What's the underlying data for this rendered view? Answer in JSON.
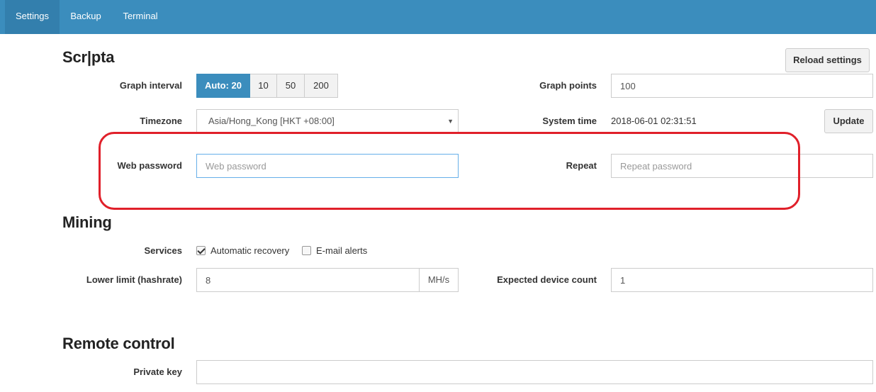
{
  "nav": {
    "tabs": [
      {
        "label": "Settings",
        "active": true
      },
      {
        "label": "Backup",
        "active": false
      },
      {
        "label": "Terminal",
        "active": false
      }
    ]
  },
  "scripta": {
    "title": "Scr|pta",
    "reload_label": "Reload settings",
    "graph_interval": {
      "label": "Graph interval",
      "options": [
        "Auto: 20",
        "10",
        "50",
        "200"
      ],
      "selected": "Auto: 20"
    },
    "graph_points": {
      "label": "Graph points",
      "value": "100"
    },
    "timezone": {
      "label": "Timezone",
      "value": "Asia/Hong_Kong [HKT +08:00]"
    },
    "system_time": {
      "label": "System time",
      "value": "2018-06-01 02:31:51",
      "update_label": "Update"
    },
    "web_password": {
      "label": "Web password",
      "placeholder": "Web password"
    },
    "repeat": {
      "label": "Repeat",
      "placeholder": "Repeat password"
    }
  },
  "mining": {
    "title": "Mining",
    "services": {
      "label": "Services",
      "automatic_recovery": {
        "label": "Automatic recovery",
        "checked": true
      },
      "email_alerts": {
        "label": "E-mail alerts",
        "checked": false
      }
    },
    "lower_limit": {
      "label": "Lower limit (hashrate)",
      "value": "8",
      "unit": "MH/s"
    },
    "expected_devices": {
      "label": "Expected device count",
      "value": "1"
    }
  },
  "remote": {
    "title": "Remote control",
    "private_key": {
      "label": "Private key",
      "value": ""
    }
  },
  "colors": {
    "navbar": "#3b8dbd",
    "active_tab": "#337fad",
    "primary": "#3b8dbd",
    "annotation": "#e0202a"
  }
}
